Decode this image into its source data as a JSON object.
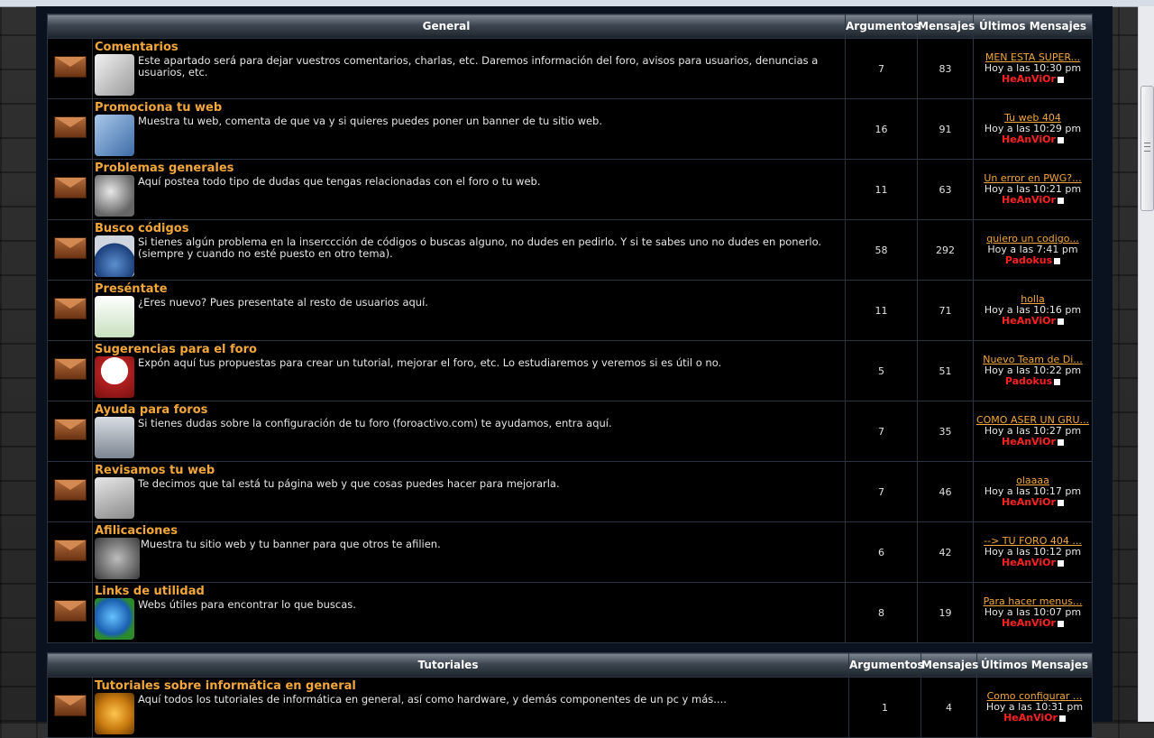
{
  "sections": [
    {
      "title": "General",
      "col_topics": "Argumentos",
      "col_posts": "Mensajes",
      "col_last": "Últimos Mensajes",
      "forums": [
        {
          "name": "Comentarios",
          "desc": "Este apartado será para dejar vuestros comentarios, charlas, etc. Daremos información del foro, avisos para usuarios, denuncias a usuarios, etc.",
          "icon": "notepad-pencil-icon",
          "topics": "7",
          "posts": "83",
          "last_title": "MEN ESTA SUPER...",
          "last_time": "Hoy a las 10:30 pm",
          "last_user": "HeAnViOr"
        },
        {
          "name": "Promociona tu web",
          "desc": "Muestra tu web, comenta de que va y si quieres puedes poner un banner de tu sitio web.",
          "icon": "folder-icon",
          "topics": "16",
          "posts": "91",
          "last_title": "Tu web 404",
          "last_time": "Hoy a las 10:29 pm",
          "last_user": "HeAnViOr"
        },
        {
          "name": "Problemas generales",
          "desc": "Aquí postea todo tipo de dudas que tengas relacionadas con el foro o tu web.",
          "icon": "tools-icon",
          "topics": "11",
          "posts": "63",
          "last_title": "Un error en PWG?...",
          "last_time": "Hoy a las 10:21 pm",
          "last_user": "HeAnViOr"
        },
        {
          "name": "Busco códigos",
          "desc": "Si tienes algún problema en la inserccción de códigos o buscas alguno, no dudes en pedirlo. Y si te sabes uno no dudes en ponerlo. (siempre y cuando no esté puesto en otro tema).",
          "icon": "web-document-icon",
          "topics": "58",
          "posts": "292",
          "last_title": "quiero un codigo...",
          "last_time": "Hoy a las 7:41 pm",
          "last_user": "Padokus"
        },
        {
          "name": "Preséntate",
          "desc": "¿Eres nuevo? Pues presentate al resto de usuarios aquí.",
          "icon": "id-card-icon",
          "topics": "11",
          "posts": "71",
          "last_title": "holla",
          "last_time": "Hoy a las 10:16 pm",
          "last_user": "HeAnViOr"
        },
        {
          "name": "Sugerencias para el foro",
          "desc": "Expón aquí tus propuestas para crear un tutorial, mejorar el foro, etc. Lo estudiaremos y veremos si es útil o no.",
          "icon": "speech-bubble-user-icon",
          "topics": "5",
          "posts": "51",
          "last_title": "Nuevo Team de Di...",
          "last_time": "Hoy a las 10:22 pm",
          "last_user": "Padokus"
        },
        {
          "name": "Ayuda para foros",
          "desc": "Si tienes dudas sobre la configuración de tu foro (foroactivo.com) te ayudamos, entra aquí.",
          "icon": "toolbox-icon",
          "topics": "7",
          "posts": "35",
          "last_title": "COMO ASER UN GRU...",
          "last_time": "Hoy a las 10:27 pm",
          "last_user": "HeAnViOr"
        },
        {
          "name": "Revisamos tu web",
          "desc": "Te decimos que tal está tu página web y que cosas puedes hacer para mejorarla.",
          "icon": "clipboard-icon",
          "topics": "7",
          "posts": "46",
          "last_title": "olaaaa",
          "last_time": "Hoy a las 10:17 pm",
          "last_user": "HeAnViOr"
        },
        {
          "name": "Afilicaciones",
          "desc": "Muestra tu sitio web y tu banner para que otros te afilien.",
          "icon": "handshake-icon",
          "topics": "6",
          "posts": "42",
          "last_title": "--> TU FORO 404 ...",
          "last_time": "Hoy a las 10:12 pm",
          "last_user": "HeAnViOr"
        },
        {
          "name": "Links de utilidad",
          "desc": "Webs útiles para encontrar lo que buscas.",
          "icon": "globe-computer-icon",
          "topics": "8",
          "posts": "19",
          "last_title": "Para hacer menus...",
          "last_time": "Hoy a las 10:07 pm",
          "last_user": "HeAnViOr"
        }
      ]
    },
    {
      "title": "Tutoriales",
      "col_topics": "Argumentos",
      "col_posts": "Mensajes",
      "col_last": "Últimos Mensajes",
      "forums": [
        {
          "name": "Tutoriales sobre informática en general",
          "desc": "Aquí todos los tutoriales de informática en general, así como hardware, y demás componentes de un pc y más....",
          "icon": "orb-icon",
          "topics": "1",
          "posts": "4",
          "last_title": "Como configurar ...",
          "last_time": "Hoy a las 10:31 pm",
          "last_user": "HeAnViOr"
        }
      ]
    }
  ]
}
